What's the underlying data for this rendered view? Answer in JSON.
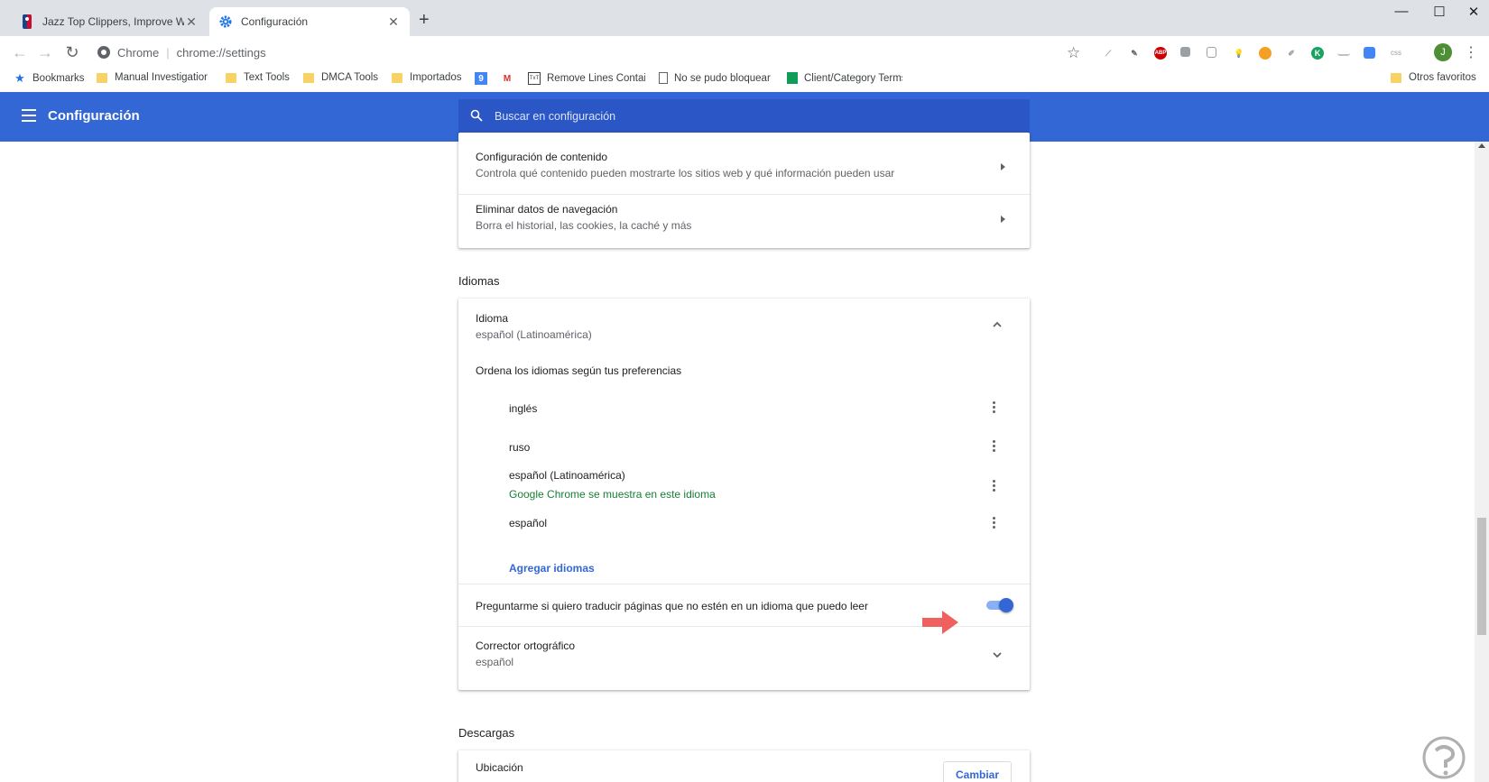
{
  "tabs": [
    {
      "title": "Jazz Top Clippers, Improve Win Streak",
      "active": false,
      "close": "✕"
    },
    {
      "title": "Configuración",
      "active": true,
      "close": "✕"
    }
  ],
  "window_controls": {
    "minimize": "—",
    "maximize": "☐",
    "close": "✕"
  },
  "toolbar": {
    "origin": "Chrome",
    "url": "chrome://settings",
    "avatar_letter": "J",
    "extensions": [
      "brush-icon",
      "stamp-icon",
      "abp-icon",
      "copy-icon",
      "pages-icon",
      "bulb-icon",
      "key-icon",
      "eyedropper-icon",
      "k-icon",
      "ruler-icon",
      "translate-icon",
      "css-icon"
    ],
    "abp_label": "ABP",
    "css_label": "css",
    "k_label": "K"
  },
  "bookmarks": {
    "items": [
      {
        "label": "Bookmarks",
        "icon": "star-icon"
      },
      {
        "label": "Manual Investigation",
        "icon": "folder-icon"
      },
      {
        "label": "Text Tools",
        "icon": "folder-icon"
      },
      {
        "label": "DMCA Tools",
        "icon": "folder-icon"
      },
      {
        "label": "Importados",
        "icon": "folder-icon"
      },
      {
        "label": "",
        "icon": "calendar-icon"
      },
      {
        "label": "",
        "icon": "gmail-icon"
      },
      {
        "label": "Remove Lines Containing",
        "icon": "txt-icon"
      },
      {
        "label": "No se pudo bloquear",
        "icon": "page-icon"
      },
      {
        "label": "Client/Category Terms",
        "icon": "sheets-icon"
      }
    ],
    "calendar_label": "9",
    "other": "Otros favoritos"
  },
  "header": {
    "title": "Configuración",
    "search_placeholder": "Buscar en configuración"
  },
  "privacy_card": {
    "items": [
      {
        "title": "Configuración de contenido",
        "subtitle": "Controla qué contenido pueden mostrarte los sitios web y qué información pueden usar"
      },
      {
        "title": "Eliminar datos de navegación",
        "subtitle": "Borra el historial, las cookies, la caché y más"
      }
    ]
  },
  "languages": {
    "section_title": "Idiomas",
    "idioma_title": "Idioma",
    "idioma_value": "español (Latinoamérica)",
    "order_label": "Ordena los idiomas según tus preferencias",
    "items": [
      {
        "name": "inglés"
      },
      {
        "name": "ruso"
      },
      {
        "name": "español (Latinoamérica)",
        "note": "Google Chrome se muestra en este idioma"
      },
      {
        "name": "español"
      }
    ],
    "add_link": "Agregar idiomas",
    "translate_label": "Preguntarme si quiero traducir páginas que no estén en un idioma que puedo leer",
    "translate_enabled": true,
    "spell_title": "Corrector ortográfico",
    "spell_value": "español"
  },
  "downloads": {
    "section_title": "Descargas",
    "location_title": "Ubicación",
    "change_button": "Cambiar"
  },
  "colors": {
    "header_blue": "#3367d6",
    "search_bg": "#2a56c6",
    "link_blue": "#3367d6",
    "note_green": "#188038",
    "annotation_red": "#f0605f"
  }
}
